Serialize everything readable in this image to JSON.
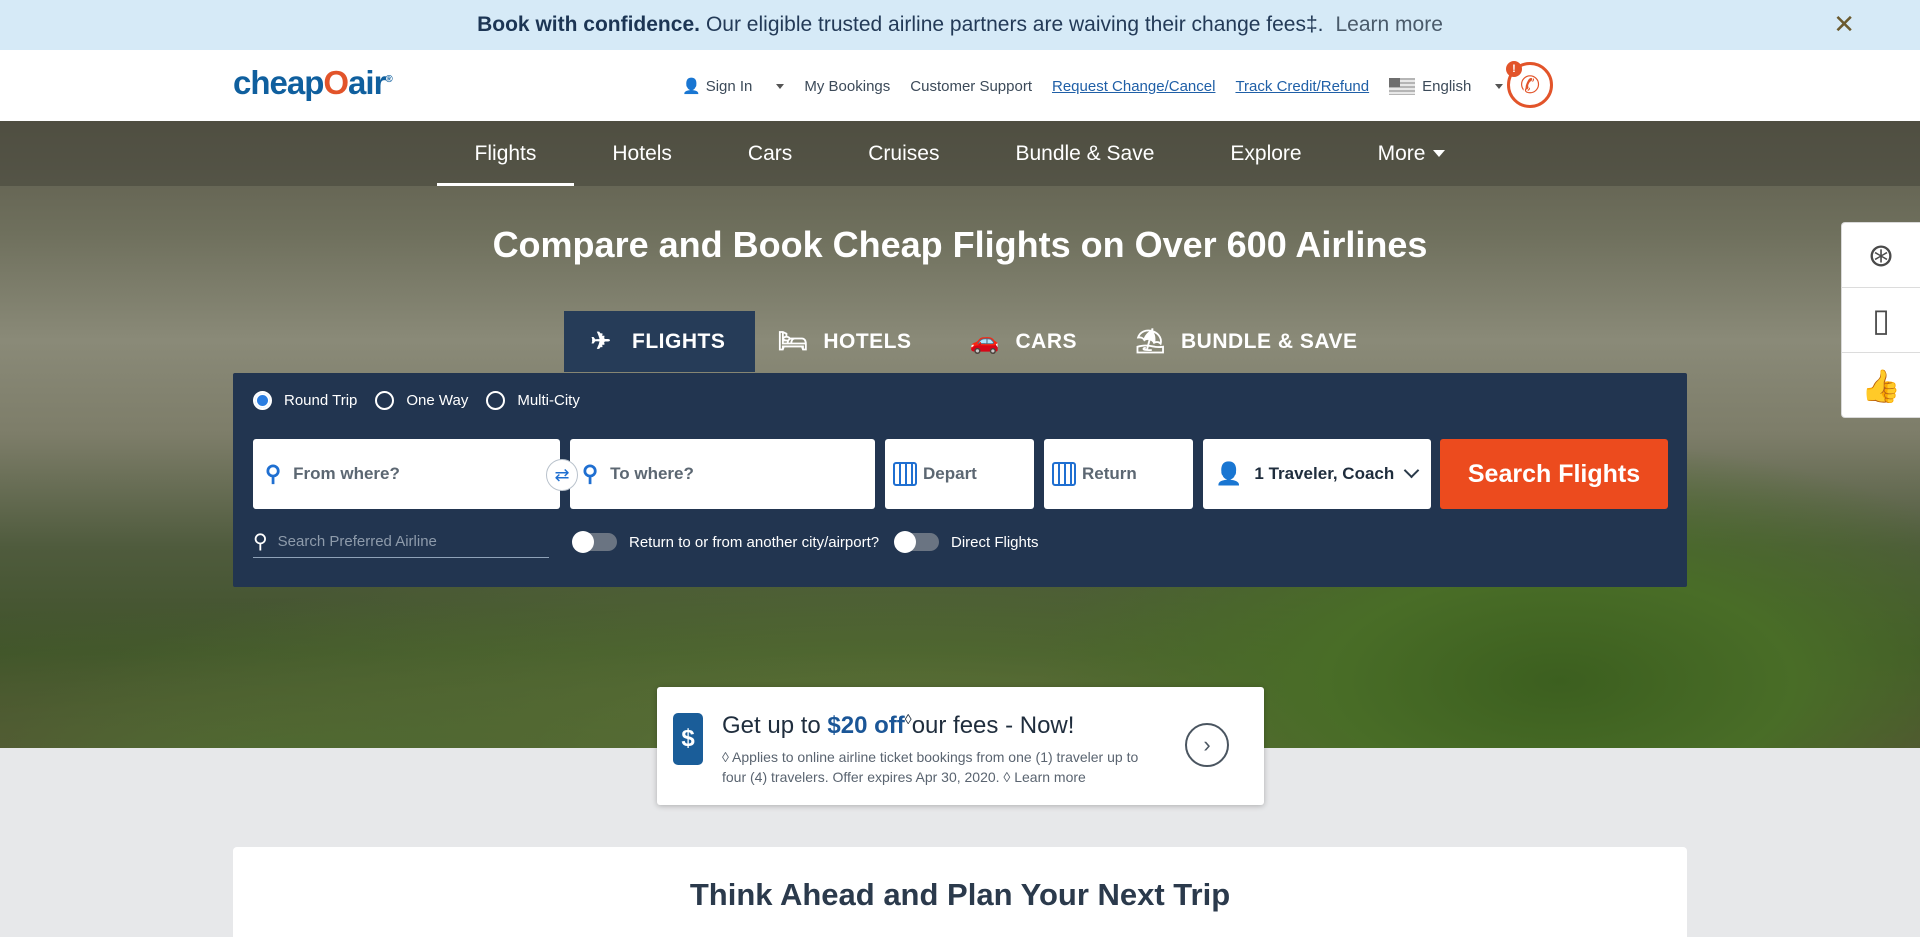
{
  "banner": {
    "bold": "Book with confidence.",
    "message": "Our eligible trusted airline partners are waiving their change fees‡.",
    "learn_more": "Learn more",
    "close": "✕"
  },
  "header": {
    "logo_a": "cheap",
    "logo_o": "O",
    "logo_b": "air",
    "logo_reg": "®",
    "sign_in": "Sign In",
    "my_bookings": "My Bookings",
    "customer_support": "Customer Support",
    "request_change": "Request Change/Cancel",
    "track_credit": "Track Credit/Refund",
    "language": "English",
    "phone_badge": "!"
  },
  "nav": {
    "items": [
      "Flights",
      "Hotels",
      "Cars",
      "Cruises",
      "Bundle & Save",
      "Explore",
      "More"
    ]
  },
  "hero": {
    "title": "Compare and Book Cheap Flights on Over 600 Airlines"
  },
  "product_tabs": [
    "FLIGHTS",
    "HOTELS",
    "CARS",
    "BUNDLE & SAVE"
  ],
  "search": {
    "trip_types": [
      "Round Trip",
      "One Way",
      "Multi-City"
    ],
    "selected_trip": "Round Trip",
    "from_placeholder": "From where?",
    "to_placeholder": "To where?",
    "depart": "Depart",
    "return": "Return",
    "travelers": "1 Traveler, Coach",
    "button": "Search Flights",
    "airline_placeholder": "Search Preferred Airline",
    "alt_airport_label": "Return to or from another city/airport?",
    "direct_label": "Direct Flights"
  },
  "promo": {
    "prefix": "Get up to ",
    "amount": "$20 off",
    "mark": "◊",
    "suffix": "our fees - Now!",
    "fine_print": "◊ Applies to online airline ticket bookings from one (1) traveler up to four (4) travelers. Offer expires Apr 30, 2020. ◊ Learn more"
  },
  "plan": {
    "title": "Think Ahead and Plan Your Next Trip"
  },
  "colors": {
    "brand_blue": "#0f5f9e",
    "brand_orange": "#e2542a",
    "search_button": "#ec4b1e",
    "search_panel": "#223550"
  }
}
